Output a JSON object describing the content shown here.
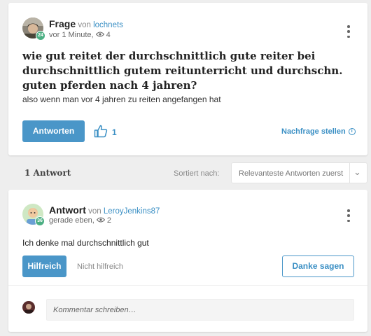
{
  "question": {
    "type_label": "Frage",
    "by_word": "von",
    "username": "lochnets",
    "user_badge": "24",
    "time": "vor 1 Minute,",
    "views": "4",
    "title": "wie gut reitet der durchschnittlich gute reiter bei durchschnittlich gutem reitunterricht und durchschn. guten pferden nach 4 jahren?",
    "body": "also wenn man vor 4 jahren zu reiten angefangen hat",
    "answer_button": "Antworten",
    "likes": "1",
    "followup_link": "Nachfrage stellen",
    "icons": {
      "views": "eye-icon",
      "like": "thumbs-up-icon",
      "info": "info-icon",
      "menu": "more-vertical-icon"
    }
  },
  "answers_bar": {
    "count_label": "1 Antwort",
    "sort_label": "Sortiert nach:",
    "sort_value": "Relevanteste Antworten zuerst"
  },
  "answer": {
    "type_label": "Antwort",
    "by_word": "von",
    "username": "LeroyJenkins87",
    "user_badge": "36",
    "time": "gerade eben,",
    "views": "2",
    "body": "Ich denke mal durchschnittlich gut",
    "helpful_button": "Hilfreich",
    "not_helpful": "Nicht hilfreich",
    "thanks_button": "Danke sagen",
    "comment_placeholder": "Kommentar schreiben…"
  },
  "colors": {
    "accent": "#4a96c8",
    "link": "#3a8fc4",
    "badge": "#4caf83",
    "background": "#eeeeee"
  }
}
